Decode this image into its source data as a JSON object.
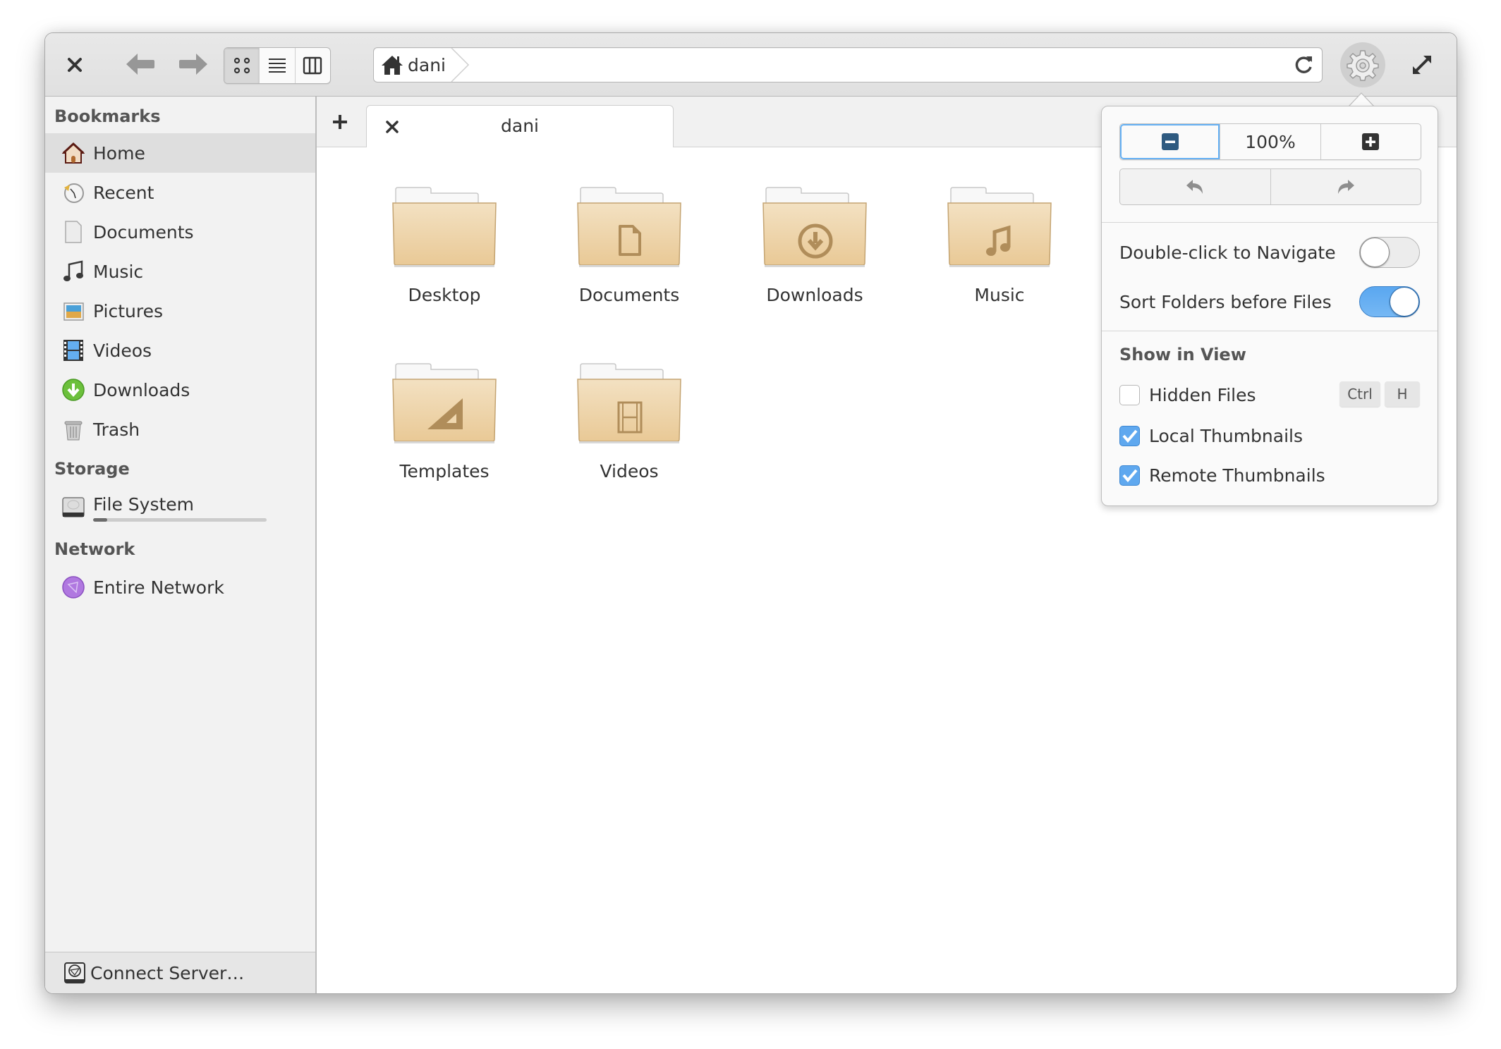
{
  "header": {
    "close_icon": "close-icon",
    "back_icon": "arrow-left-icon",
    "forward_icon": "arrow-right-icon",
    "view_modes": [
      {
        "name": "icon-view",
        "icon": "grid-icon",
        "active": true
      },
      {
        "name": "list-view",
        "icon": "list-icon",
        "active": false
      },
      {
        "name": "column-view",
        "icon": "columns-icon",
        "active": false
      }
    ],
    "breadcrumb": [
      {
        "label": "dani",
        "icon": "home-icon"
      }
    ],
    "reload_icon": "reload-icon",
    "menu_icon": "gear-icon",
    "maximize_icon": "maximize-icon"
  },
  "sidebar": {
    "sections": [
      {
        "title": "Bookmarks",
        "items": [
          {
            "label": "Home",
            "icon": "home-icon",
            "selected": true
          },
          {
            "label": "Recent",
            "icon": "recent-icon"
          },
          {
            "label": "Documents",
            "icon": "document-icon"
          },
          {
            "label": "Music",
            "icon": "music-icon"
          },
          {
            "label": "Pictures",
            "icon": "pictures-icon"
          },
          {
            "label": "Videos",
            "icon": "video-icon"
          },
          {
            "label": "Downloads",
            "icon": "download-icon"
          },
          {
            "label": "Trash",
            "icon": "trash-icon"
          }
        ]
      },
      {
        "title": "Storage",
        "items": [
          {
            "label": "File System",
            "icon": "harddisk-icon",
            "usage_percent": 8
          }
        ]
      },
      {
        "title": "Network",
        "items": [
          {
            "label": "Entire Network",
            "icon": "network-icon"
          }
        ]
      }
    ],
    "footer": {
      "label": "Connect Server…",
      "icon": "connect-server-icon"
    }
  },
  "tabs": {
    "new_tab_label": "+",
    "items": [
      {
        "label": "dani",
        "close_label": "×"
      }
    ]
  },
  "folders": [
    {
      "label": "Desktop",
      "emblem": "none"
    },
    {
      "label": "Documents",
      "emblem": "document"
    },
    {
      "label": "Downloads",
      "emblem": "download"
    },
    {
      "label": "Music",
      "emblem": "music"
    },
    {
      "label": "Templates",
      "emblem": "template"
    },
    {
      "label": "Videos",
      "emblem": "video"
    }
  ],
  "menu": {
    "zoom_level": "100%",
    "zoom_out_icon": "zoom-out-icon",
    "zoom_in_icon": "zoom-in-icon",
    "undo_icon": "undo-icon",
    "redo_icon": "redo-icon",
    "toggles": [
      {
        "label": "Double-click to Navigate",
        "on": false
      },
      {
        "label": "Sort Folders before Files",
        "on": true
      }
    ],
    "show_in_view_heading": "Show in View",
    "checks": [
      {
        "label": "Hidden Files",
        "checked": false,
        "shortcut": [
          "Ctrl",
          "H"
        ]
      },
      {
        "label": "Local Thumbnails",
        "checked": true
      },
      {
        "label": "Remote Thumbnails",
        "checked": true
      }
    ]
  },
  "colors": {
    "accent": "#64b0f4",
    "folder": "#eacb98",
    "folder_emblem": "#b08d5a"
  }
}
